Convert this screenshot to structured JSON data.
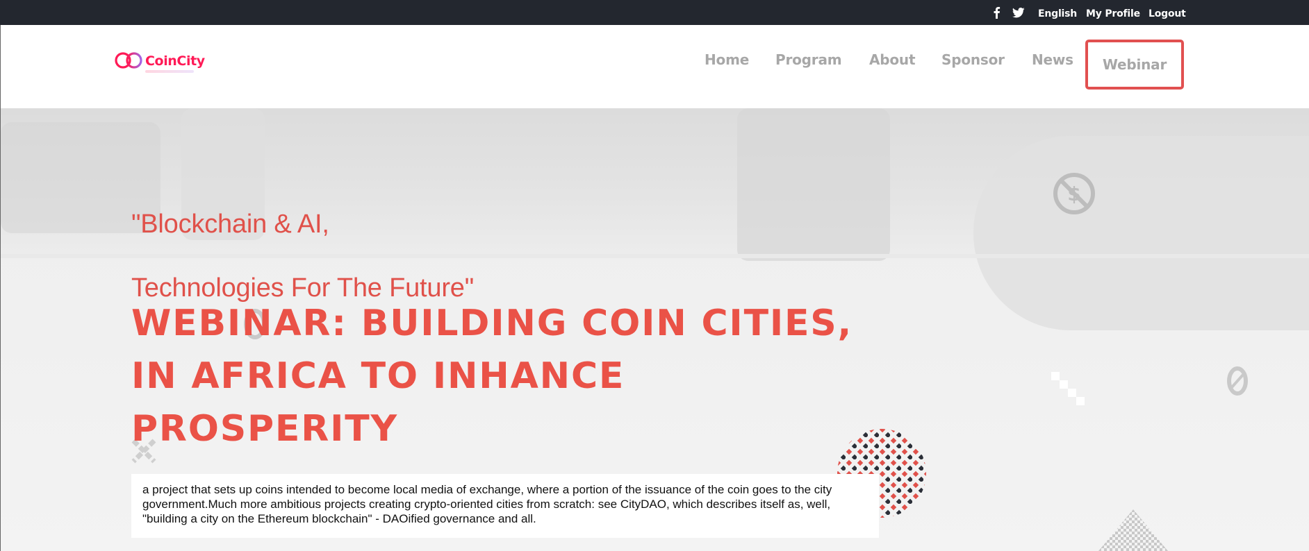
{
  "topbar": {
    "social": {
      "facebook_icon": "facebook-icon",
      "twitter_icon": "twitter-icon"
    },
    "language": "English",
    "profile": "My Profile",
    "logout": "Logout"
  },
  "brand": {
    "name": "CoinCity",
    "colors": {
      "primary": "#ff1a56",
      "secondary": "#a366e6"
    }
  },
  "nav": {
    "items": [
      "Home",
      "Program",
      "About",
      "Sponsor",
      "News"
    ],
    "active": "Webinar"
  },
  "hero": {
    "quote_line1": "\"Blockchain & AI,",
    "quote_line2": "Technologies For The Future\"",
    "headline_line1": "WEBINAR: BUILDING COIN CITIES,",
    "headline_line2": "IN AFRICA TO INHANCE",
    "headline_line3": "PROSPERITY",
    "description": "a project that sets up coins intended to become local media of exchange, where a portion of the issuance of the coin goes to the city government.Much more ambitious projects creating crypto-oriented cities from scratch: see CityDAO, which describes itself as, well, \"building a city on the Ethereum blockchain\" - DAOified governance and all."
  },
  "colors": {
    "accent": "#ea5247",
    "topbar_bg": "#23272f",
    "nav_text": "#a7a7a7"
  }
}
